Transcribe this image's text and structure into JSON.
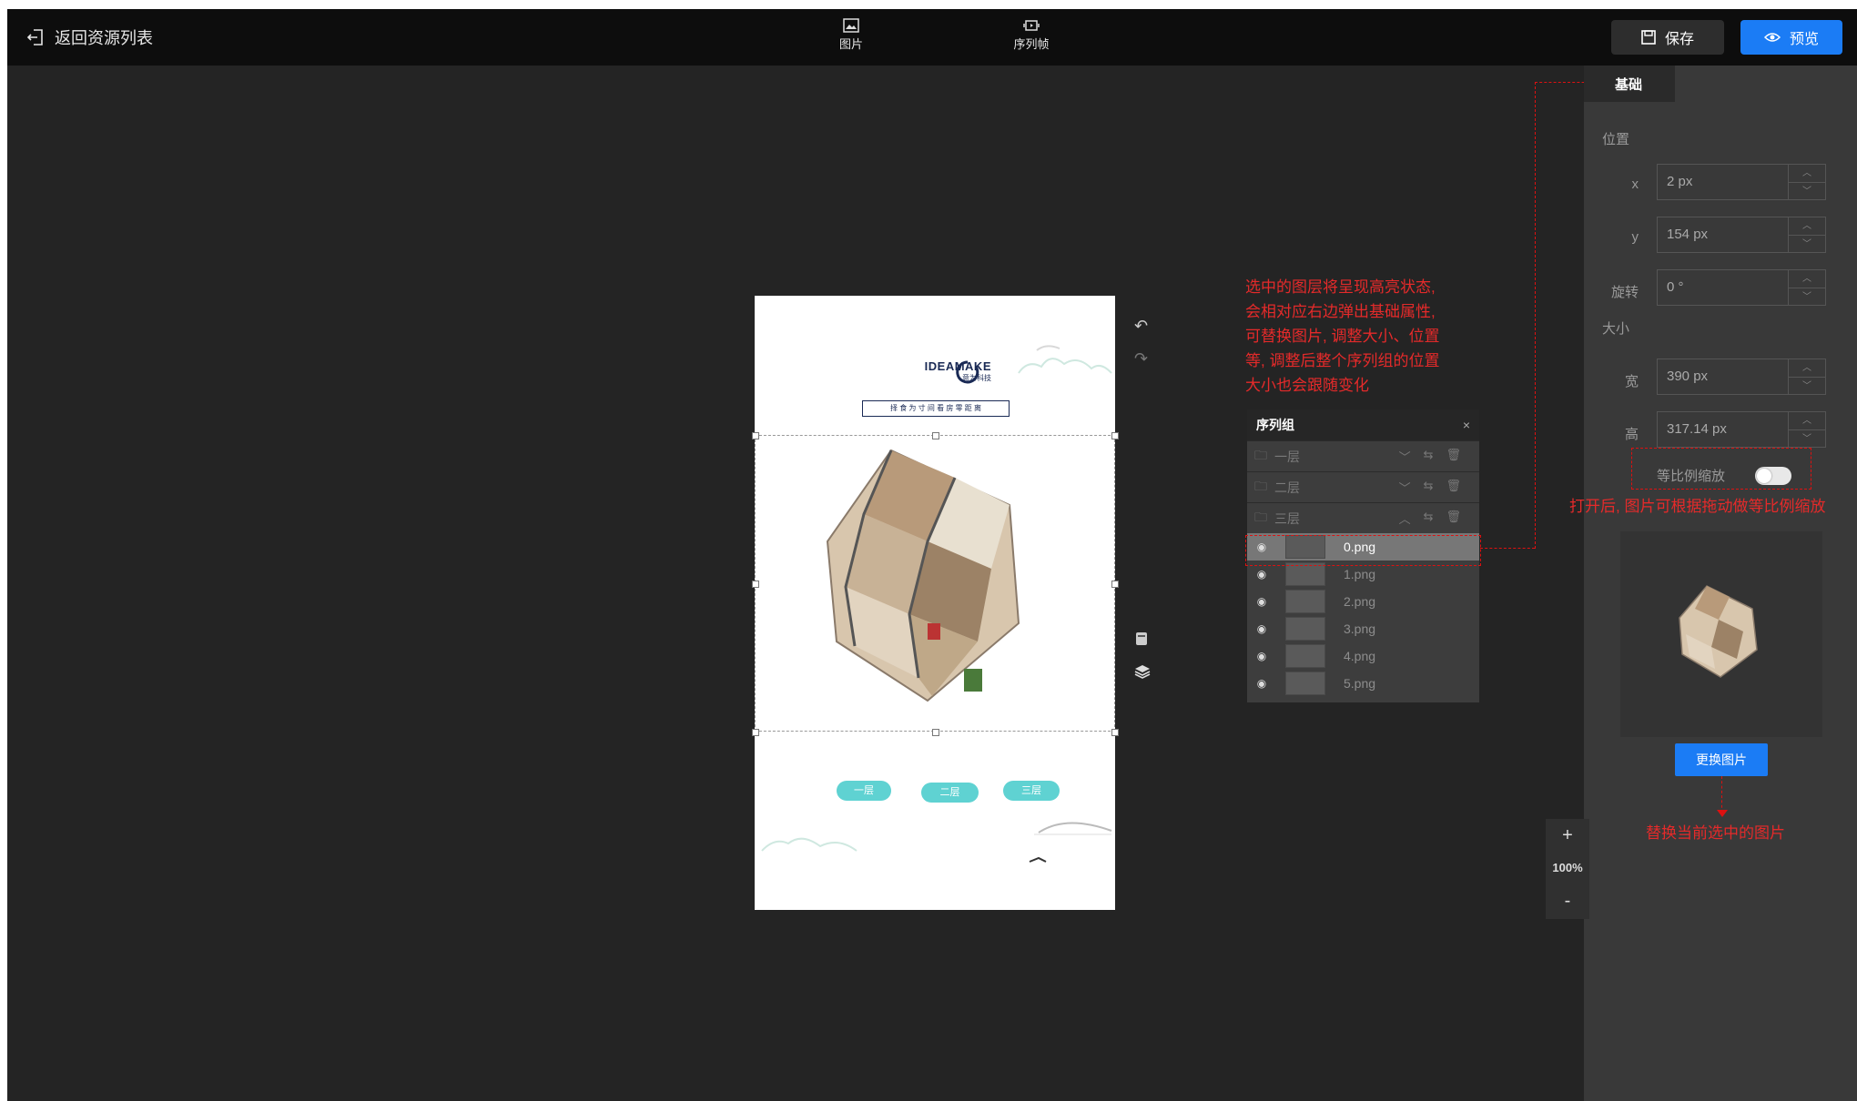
{
  "header": {
    "back_label": "返回资源列表",
    "tools": [
      {
        "label": "图片",
        "icon": "image-icon"
      },
      {
        "label": "序列帧",
        "icon": "sequence-frame-icon"
      }
    ],
    "save_label": "保存",
    "preview_label": "预览"
  },
  "canvas": {
    "logo_main": "IDEAMAKE",
    "logo_sub": "意为科技",
    "slogan": "择 食 为 寸 间   看 房 零 距 离",
    "floor_buttons": [
      "一层",
      "二层",
      "三层"
    ]
  },
  "annotations": {
    "selected_note": [
      "选中的图层将呈现高亮状态,",
      "会相对应右边弹出基础属性,",
      "可替换图片, 调整大小、位置",
      "等, 调整后整个序列组的位置",
      "大小也会跟随变化"
    ],
    "scale_note": "打开后, 图片可根据拖动做等比例缩放",
    "replace_note": "替换当前选中的图片"
  },
  "layers_panel": {
    "title": "序列组",
    "close": "×",
    "groups": [
      {
        "label": "一层",
        "expanded": false
      },
      {
        "label": "二层",
        "expanded": false
      },
      {
        "label": "三层",
        "expanded": true
      }
    ],
    "frames": [
      {
        "name": "0.png",
        "selected": true
      },
      {
        "name": "1.png",
        "selected": false
      },
      {
        "name": "2.png",
        "selected": false
      },
      {
        "name": "3.png",
        "selected": false
      },
      {
        "name": "4.png",
        "selected": false
      },
      {
        "name": "5.png",
        "selected": false
      }
    ]
  },
  "properties": {
    "tab": "基础",
    "position_title": "位置",
    "x_label": "x",
    "x_value": "2 px",
    "y_label": "y",
    "y_value": "154 px",
    "rotate_label": "旋转",
    "rotate_value": "0 °",
    "size_title": "大小",
    "width_label": "宽",
    "width_value": "390 px",
    "height_label": "高",
    "height_value": "317.14 px",
    "proportional_label": "等比例缩放",
    "replace_button": "更换图片"
  },
  "zoom": {
    "plus": "+",
    "level": "100%",
    "minus": "-"
  },
  "colors": {
    "accent": "#1b7cf5",
    "annotation": "#e52a2a",
    "teal": "#5fd2d2"
  }
}
